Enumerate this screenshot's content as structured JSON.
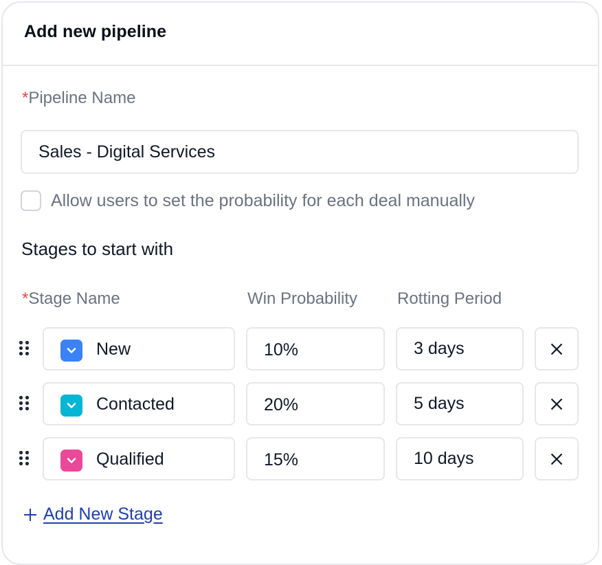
{
  "dialog": {
    "title": "Add new pipeline"
  },
  "pipeline_name": {
    "required_marker": "*",
    "label": "Pipeline Name",
    "value": "Sales - Digital Services"
  },
  "manual_probability": {
    "checked": false,
    "label": "Allow users to set the probability for each deal manually"
  },
  "stages_section": {
    "title": "Stages to start with",
    "columns": {
      "stage_name_required_marker": "*",
      "stage_name": "Stage Name",
      "win_probability": "Win Probability",
      "rotting_period": "Rotting Period"
    },
    "stages": [
      {
        "name": "New",
        "color": "#3b82f6",
        "win_probability": "10%",
        "rotting_period": "3 days"
      },
      {
        "name": "Contacted",
        "color": "#06b6d4",
        "win_probability": "20%",
        "rotting_period": "5 days"
      },
      {
        "name": "Qualified",
        "color": "#ec4899",
        "win_probability": "15%",
        "rotting_period": "10 days"
      }
    ],
    "add_stage_label": "Add New Stage"
  },
  "colors": {
    "required": "#ef4444",
    "link": "#1e40af",
    "border": "#e5e7eb",
    "muted_text": "#6b7280"
  }
}
